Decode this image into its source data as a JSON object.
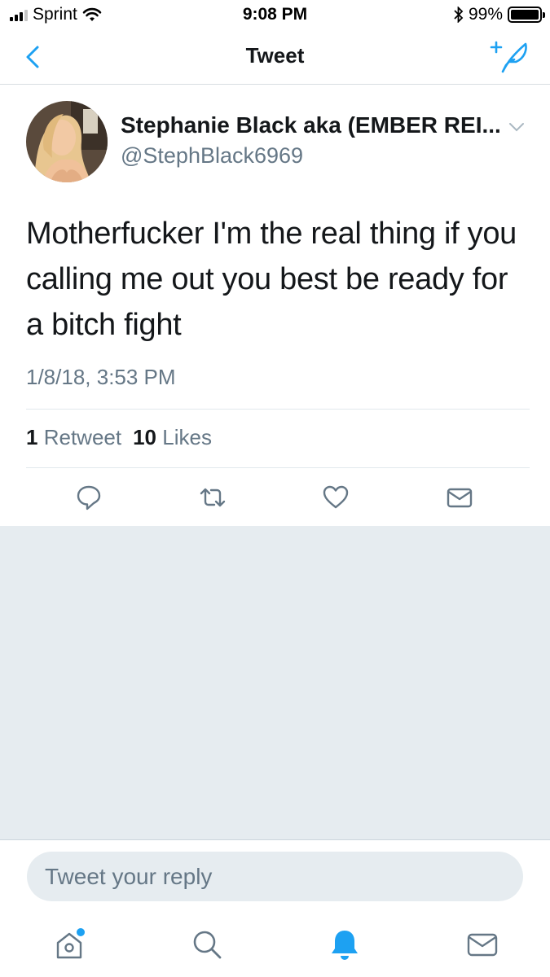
{
  "status_bar": {
    "carrier": "Sprint",
    "time": "9:08 PM",
    "battery": "99%",
    "battery_level": 0.99
  },
  "nav": {
    "title": "Tweet"
  },
  "tweet": {
    "author_name": "Stephanie Black aka (EMBER REI...",
    "author_handle": "@StephBlack6969",
    "text": "Motherfucker I'm the real thing if you calling me out you best be ready for a bitch fight",
    "timestamp": "1/8/18, 3:53 PM",
    "retweet_count": "1",
    "retweet_label": "Retweet",
    "like_count": "10",
    "like_label": "Likes"
  },
  "reply": {
    "placeholder": "Tweet your reply"
  },
  "tab_bar": {
    "items": [
      "home-icon",
      "search-icon",
      "notifications-icon",
      "messages-icon"
    ],
    "active": "notifications-icon"
  },
  "colors": {
    "accent": "#1da1f2",
    "text_primary": "#14171a",
    "text_secondary": "#657786",
    "background_grey": "#e6ecf0"
  }
}
